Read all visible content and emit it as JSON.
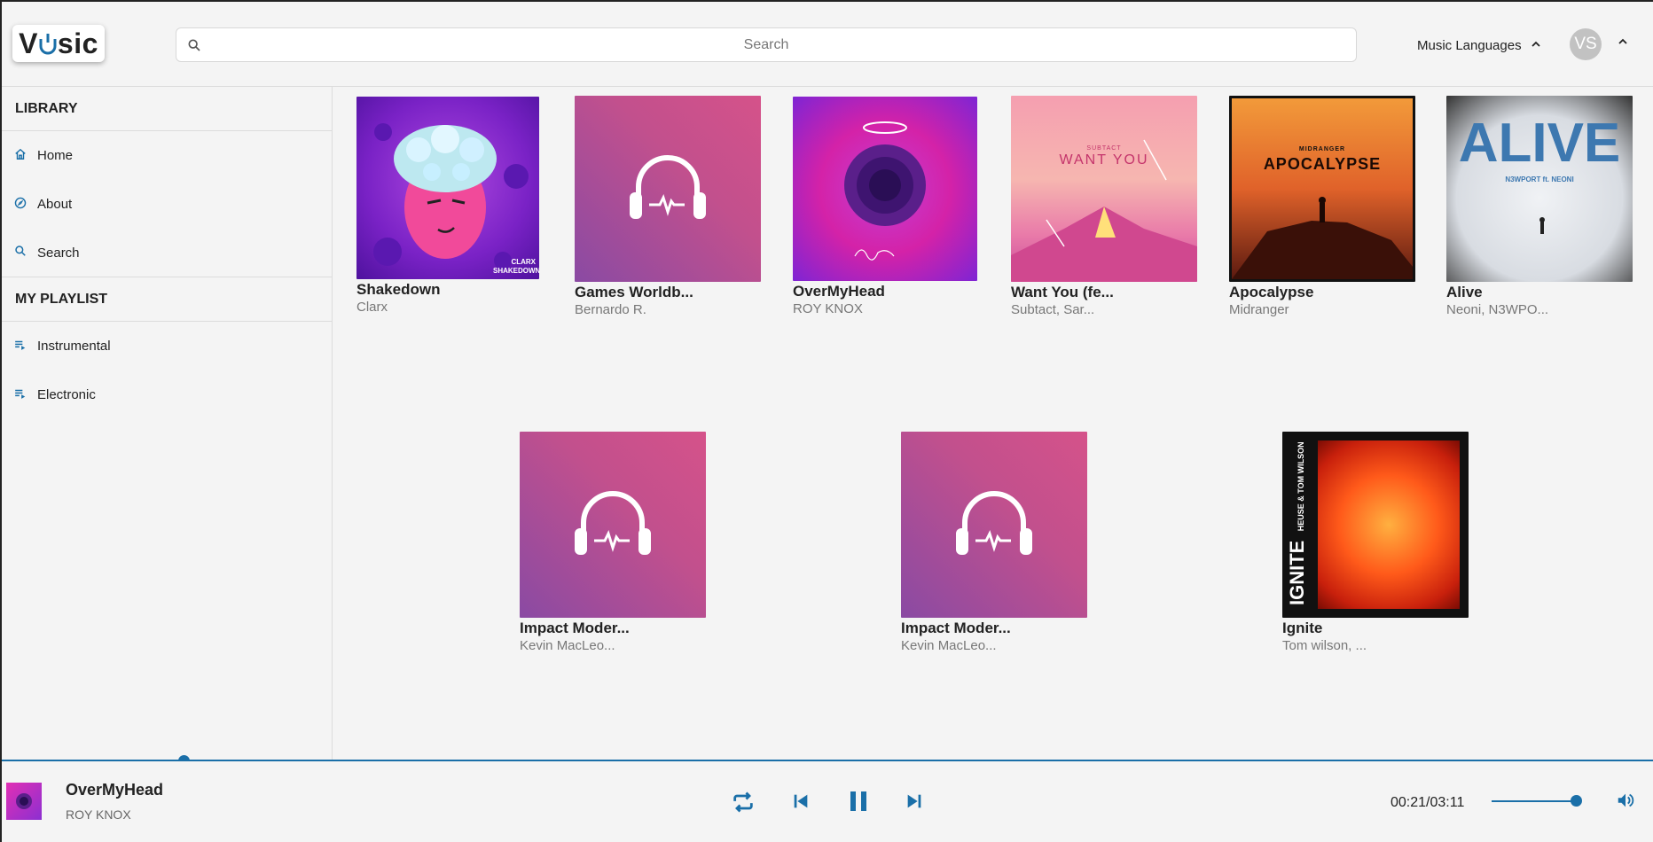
{
  "header": {
    "logo_left": "V",
    "logo_u": "U",
    "logo_right": "sic",
    "search_placeholder": "Search",
    "languages_label": "Music Languages",
    "avatar_initials": "VS"
  },
  "sidebar": {
    "library_title": "LIBRARY",
    "library_items": [
      {
        "label": "Home",
        "icon": "home-icon"
      },
      {
        "label": "About",
        "icon": "compass-icon"
      },
      {
        "label": "Search",
        "icon": "search-icon"
      }
    ],
    "playlist_title": "MY PLAYLIST",
    "playlist_items": [
      {
        "label": "Instrumental",
        "icon": "playlist-icon"
      },
      {
        "label": "Electronic",
        "icon": "playlist-icon"
      }
    ]
  },
  "songs": [
    {
      "title": "Shakedown",
      "artist": "Clarx",
      "art_text": "CLARX SHAKEDOWN"
    },
    {
      "title": "Games Worldb...",
      "artist": "Bernardo R."
    },
    {
      "title": "OverMyHead",
      "artist": "ROY KNOX"
    },
    {
      "title": "Want You (fe...",
      "artist": "Subtact, Sar...",
      "art_text": "WANT YOU",
      "art_top": "SUBTACT"
    },
    {
      "title": "Apocalypse",
      "artist": "Midranger",
      "art_text": "APOCALYPSE",
      "art_top": "MIDRANGER"
    },
    {
      "title": "Alive",
      "artist": "Neoni, N3WPO...",
      "art_text": "ALIVE",
      "art_sub": "N3WPORT ft. NEONI"
    },
    {
      "title": "Impact Moder...",
      "artist": "Kevin MacLeo..."
    },
    {
      "title": "Impact Moder...",
      "artist": "Kevin MacLeo..."
    },
    {
      "title": "Ignite",
      "artist": "Tom wilson, ...",
      "art_text": "IGNITE",
      "art_sub": "HEUSE & TOM WILSON"
    }
  ],
  "player": {
    "title": "OverMyHead",
    "artist": "ROY KNOX",
    "time": "00:21/03:11",
    "progress": 0.11,
    "volume": 0.95,
    "accent": "#1a6fa8"
  }
}
